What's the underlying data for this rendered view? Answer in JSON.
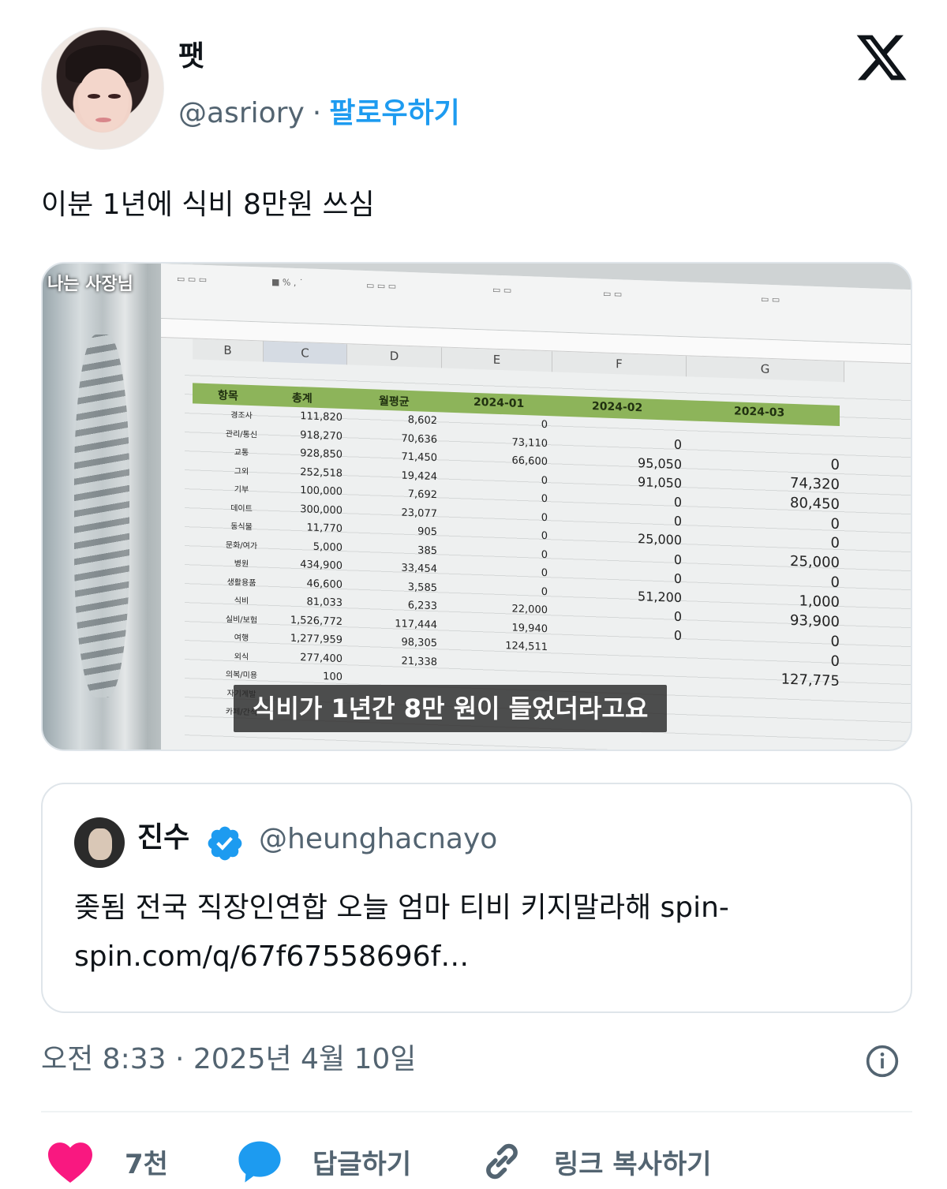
{
  "author": {
    "display_name": "팻",
    "handle": "@asriory",
    "separator": "·",
    "follow_label": "팔로우하기"
  },
  "brand_icon": "x-logo-icon",
  "tweet": {
    "text": "이분 1년에 식비 8만원 쓰심"
  },
  "media": {
    "channel_watermark": "나는 사장님",
    "subtitle": "식비가 1년간 8만 원이 들었더라고요",
    "sheet": {
      "columns": [
        "B",
        "C",
        "D",
        "E",
        "F",
        "G"
      ],
      "headers": [
        "항목",
        "총계",
        "월평균",
        "2024-01",
        "2024-02",
        "2024-03"
      ],
      "categories": [
        "경조사",
        "관리/통신",
        "교통",
        "그외",
        "기부",
        "데이트",
        "동식물",
        "문화/여가",
        "병원",
        "생활용품",
        "식비",
        "실비/보험",
        "여행",
        "외식",
        "의복/미용",
        "자기계발",
        "카페/간식"
      ],
      "totals": [
        "111,820",
        "918,270",
        "928,850",
        "252,518",
        "100,000",
        "300,000",
        "11,770",
        "5,000",
        "434,900",
        "46,600",
        "81,033",
        "1,526,772",
        "1,277,959",
        "277,400",
        "100"
      ],
      "monthly_avg": [
        "8,602",
        "70,636",
        "71,450",
        "19,424",
        "7,692",
        "23,077",
        "905",
        "385",
        "33,454",
        "3,585",
        "6,233",
        "117,444",
        "98,305",
        "21,338"
      ],
      "m2024_01": [
        "0",
        "73,110",
        "66,600",
        "0",
        "0",
        "0",
        "0",
        "0",
        "0",
        "0",
        "22,000",
        "19,940",
        "124,511"
      ],
      "m2024_02": [
        "0",
        "95,050",
        "91,050",
        "0",
        "0",
        "25,000",
        "0",
        "0",
        "51,200",
        "0",
        "0"
      ],
      "m2024_03": [
        "0",
        "74,320",
        "80,450",
        "0",
        "0",
        "25,000",
        "0",
        "1,000",
        "93,900",
        "0",
        "0",
        "127,775"
      ]
    }
  },
  "quote": {
    "display_name": "진수",
    "handle": "@heunghacnayo",
    "verified_icon": "verified-badge-icon",
    "text": "좆됨 전국 직장인연합 오늘 엄마 티비 키지말라해 spin-spin.com/q/67f67558696f…"
  },
  "meta": {
    "timestamp": "오전 8:33 · 2025년 4월 10일"
  },
  "actions": {
    "like_count": "7천",
    "reply_label": "답글하기",
    "copy_link_label": "링크 복사하기"
  },
  "colors": {
    "accent": "#1d9bf0",
    "like": "#f91880",
    "muted": "#536471",
    "sheet_header": "#8db45a"
  }
}
